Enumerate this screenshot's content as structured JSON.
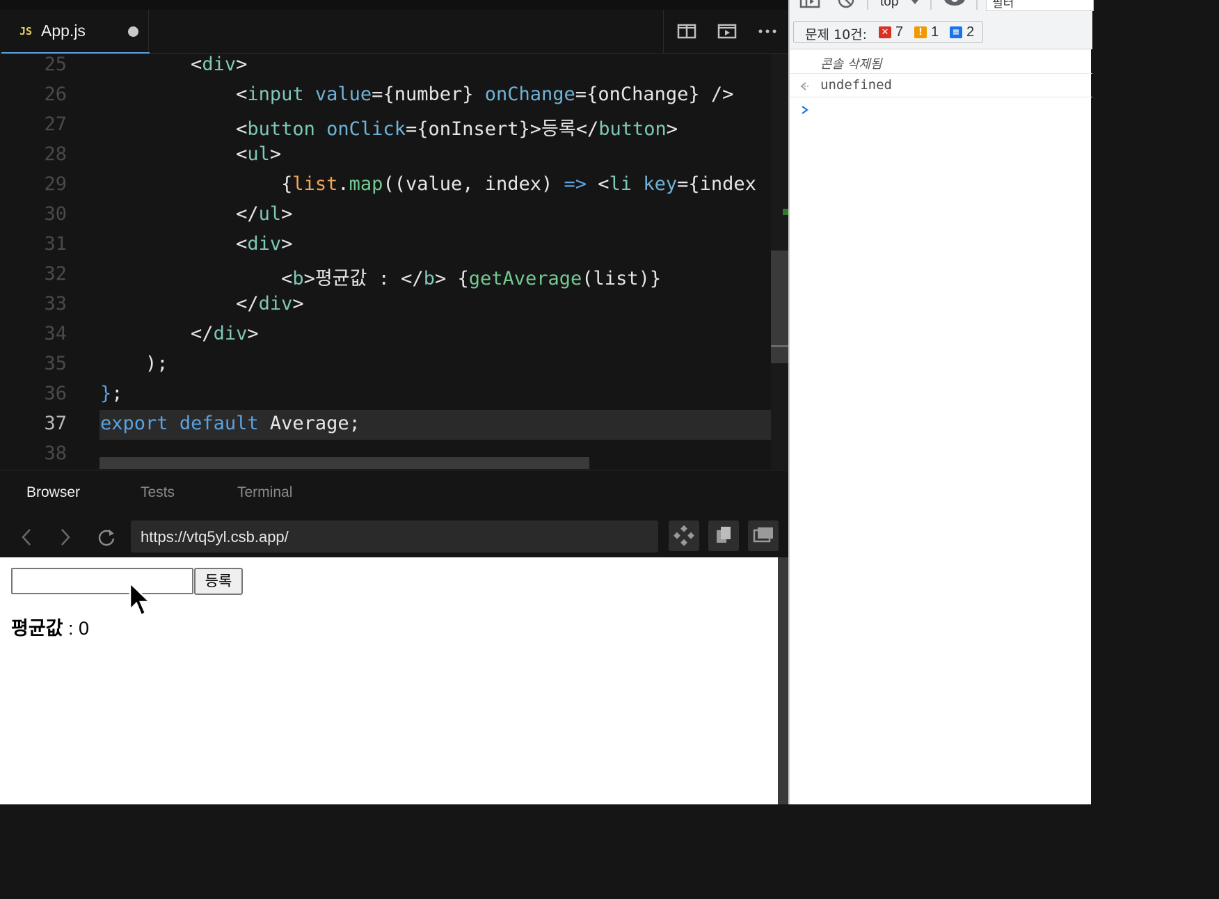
{
  "editor": {
    "tab": {
      "icon": "JS",
      "filename": "App.js"
    },
    "lines": [
      {
        "num": "25",
        "tokens": [
          {
            "t": "        ",
            "c": ""
          },
          {
            "t": "<",
            "c": "t-pun"
          },
          {
            "t": "div",
            "c": "t-tag"
          },
          {
            "t": ">",
            "c": "t-pun"
          }
        ]
      },
      {
        "num": "26",
        "tokens": [
          {
            "t": "            ",
            "c": ""
          },
          {
            "t": "<",
            "c": "t-pun"
          },
          {
            "t": "input",
            "c": "t-tag"
          },
          {
            "t": " ",
            "c": ""
          },
          {
            "t": "value",
            "c": "t-attr"
          },
          {
            "t": "=",
            "c": "t-pun"
          },
          {
            "t": "{number}",
            "c": ""
          },
          {
            "t": " ",
            "c": ""
          },
          {
            "t": "onChange",
            "c": "t-attr"
          },
          {
            "t": "=",
            "c": "t-pun"
          },
          {
            "t": "{onChange}",
            "c": ""
          },
          {
            "t": " />",
            "c": ""
          }
        ]
      },
      {
        "num": "27",
        "tokens": [
          {
            "t": "            ",
            "c": ""
          },
          {
            "t": "<",
            "c": "t-pun"
          },
          {
            "t": "button",
            "c": "t-tag"
          },
          {
            "t": " ",
            "c": ""
          },
          {
            "t": "onClick",
            "c": "t-attr"
          },
          {
            "t": "=",
            "c": "t-pun"
          },
          {
            "t": "{onInsert}",
            "c": ""
          },
          {
            "t": ">등록</",
            "c": ""
          },
          {
            "t": "button",
            "c": "t-tag"
          },
          {
            "t": ">",
            "c": ""
          }
        ]
      },
      {
        "num": "28",
        "tokens": [
          {
            "t": "            ",
            "c": ""
          },
          {
            "t": "<",
            "c": "t-pun"
          },
          {
            "t": "ul",
            "c": "t-tag"
          },
          {
            "t": ">",
            "c": "t-pun"
          }
        ]
      },
      {
        "num": "29",
        "tokens": [
          {
            "t": "                ",
            "c": ""
          },
          {
            "t": "{",
            "c": ""
          },
          {
            "t": "list",
            "c": "t-id"
          },
          {
            "t": ".",
            "c": ""
          },
          {
            "t": "map",
            "c": "t-fn"
          },
          {
            "t": "((value, index) ",
            "c": ""
          },
          {
            "t": "=>",
            "c": "t-kw"
          },
          {
            "t": " <",
            "c": ""
          },
          {
            "t": "li",
            "c": "t-tag"
          },
          {
            "t": " ",
            "c": ""
          },
          {
            "t": "key",
            "c": "t-attr"
          },
          {
            "t": "=",
            "c": "t-pun"
          },
          {
            "t": "{index",
            "c": ""
          }
        ]
      },
      {
        "num": "30",
        "tokens": [
          {
            "t": "            ",
            "c": ""
          },
          {
            "t": "</",
            "c": "t-pun"
          },
          {
            "t": "ul",
            "c": "t-tag"
          },
          {
            "t": ">",
            "c": "t-pun"
          }
        ]
      },
      {
        "num": "31",
        "tokens": [
          {
            "t": "            ",
            "c": ""
          },
          {
            "t": "<",
            "c": "t-pun"
          },
          {
            "t": "div",
            "c": "t-tag"
          },
          {
            "t": ">",
            "c": "t-pun"
          }
        ]
      },
      {
        "num": "32",
        "tokens": [
          {
            "t": "                ",
            "c": ""
          },
          {
            "t": "<",
            "c": "t-pun"
          },
          {
            "t": "b",
            "c": "t-tag"
          },
          {
            "t": ">평균값 : </",
            "c": ""
          },
          {
            "t": "b",
            "c": "t-tag"
          },
          {
            "t": "> {",
            "c": ""
          },
          {
            "t": "getAverage",
            "c": "t-fn"
          },
          {
            "t": "(list)}",
            "c": ""
          }
        ]
      },
      {
        "num": "33",
        "tokens": [
          {
            "t": "            ",
            "c": ""
          },
          {
            "t": "</",
            "c": "t-pun"
          },
          {
            "t": "div",
            "c": "t-tag"
          },
          {
            "t": ">",
            "c": "t-pun"
          }
        ]
      },
      {
        "num": "34",
        "tokens": [
          {
            "t": "        ",
            "c": ""
          },
          {
            "t": "</",
            "c": "t-pun"
          },
          {
            "t": "div",
            "c": "t-tag"
          },
          {
            "t": ">",
            "c": "t-pun"
          }
        ]
      },
      {
        "num": "35",
        "tokens": [
          {
            "t": "    );",
            "c": ""
          }
        ]
      },
      {
        "num": "36",
        "tokens": [
          {
            "t": "}",
            "c": "t-kw"
          },
          {
            "t": ";",
            "c": ""
          }
        ]
      },
      {
        "num": "37",
        "tokens": [
          {
            "t": "export",
            "c": "t-kw"
          },
          {
            "t": " ",
            "c": ""
          },
          {
            "t": "default",
            "c": "t-kw"
          },
          {
            "t": " Average;",
            "c": ""
          }
        ]
      },
      {
        "num": "38",
        "tokens": []
      }
    ],
    "active_line": "37"
  },
  "panel": {
    "tabs": [
      "Browser",
      "Tests",
      "Terminal"
    ],
    "active_tab": "Browser",
    "url": "https://vtq5yl.csb.app/"
  },
  "preview": {
    "button_label": "등록",
    "input_value": "",
    "average_label": "평균값",
    "average_value": " : 0"
  },
  "devtools": {
    "issues_label": "문제 10건:",
    "errors": "7",
    "warnings": "1",
    "info": "2",
    "console_cleared": "콘솔 삭제됨",
    "result": "undefined",
    "context": "top",
    "filter": "필터"
  },
  "colors": {
    "accent": "#5ba2e0",
    "error": "#d93025",
    "warning": "#f29900",
    "info": "#1a73e8"
  }
}
